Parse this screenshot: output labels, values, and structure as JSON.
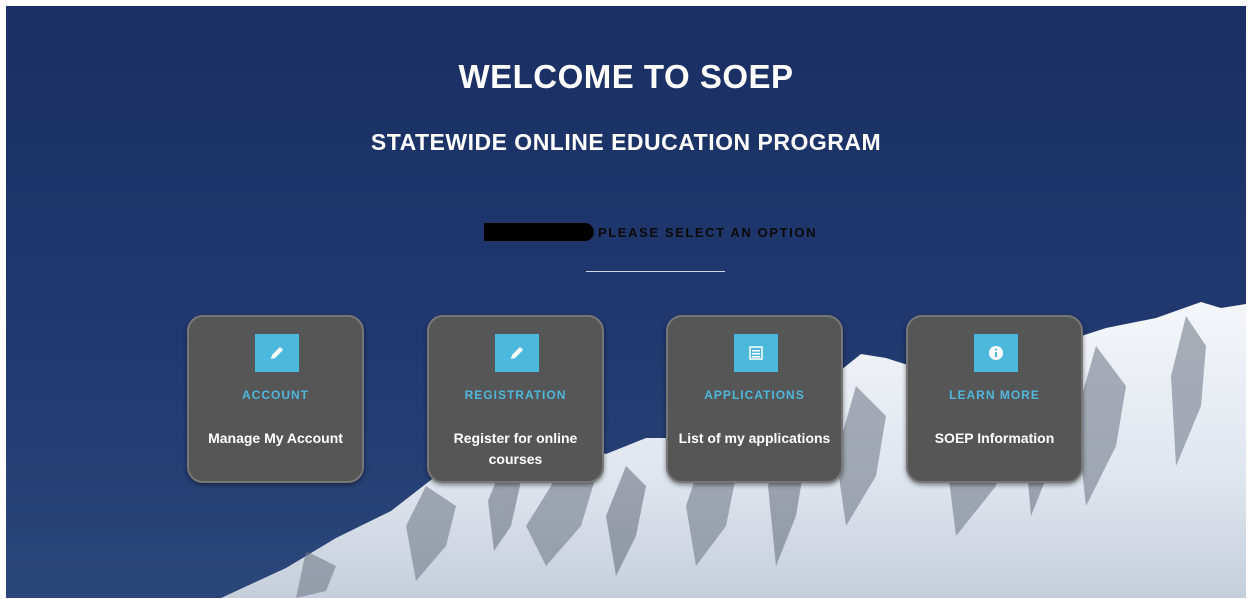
{
  "page": {
    "title": "WELCOME TO SOEP",
    "subtitle": "STATEWIDE ONLINE EDUCATION PROGRAM",
    "select_prompt": "PLEASE SELECT AN OPTION"
  },
  "colors": {
    "accent": "#4cb8dc",
    "card_bg": "#565656",
    "hero_bg": "#1d3366"
  },
  "cards": [
    {
      "label": "ACCOUNT",
      "description": "Manage My Account",
      "icon": "pencil-icon"
    },
    {
      "label": "REGISTRATION",
      "description": "Register for online courses",
      "icon": "pencil-icon"
    },
    {
      "label": "APPLICATIONS",
      "description": "List of my applications",
      "icon": "list-icon"
    },
    {
      "label": "LEARN MORE",
      "description": "SOEP Information",
      "icon": "info-icon"
    }
  ]
}
